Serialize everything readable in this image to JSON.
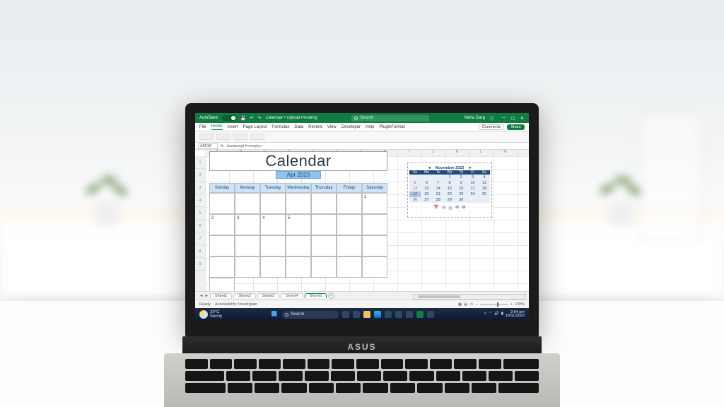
{
  "titlebar": {
    "autosave": "AutoSave",
    "doc": "Calendar • Upload Pending",
    "search_placeholder": "Search",
    "user": "Neha Garg"
  },
  "ribbon": {
    "tabs": [
      "File",
      "Home",
      "Insert",
      "Page Layout",
      "Formulas",
      "Data",
      "Review",
      "View",
      "Developer",
      "Help",
      "PlugInFormat"
    ],
    "comments": "Comments",
    "share": "Share"
  },
  "formula": {
    "cell": "A8518",
    "fx": "fx",
    "text": "Javascript #<empty>"
  },
  "columns": [
    "A",
    "B",
    "C",
    "D",
    "E",
    "F",
    "G",
    "H",
    "I",
    "J",
    "K",
    "L",
    "M"
  ],
  "rows": [
    "1",
    "2",
    "3",
    "4",
    "5",
    "6",
    "7",
    "8",
    "9"
  ],
  "calendar": {
    "title": "Calendar",
    "month_label": "Apr 2023",
    "day_headers": [
      "Sunday",
      "Monday",
      "Tuesday",
      "Wednesday",
      "Thursday",
      "Friday",
      "Saturday"
    ],
    "cells": [
      "",
      "",
      "",
      "",
      "",
      "",
      "1",
      "2",
      "3",
      "4",
      "5",
      "",
      "",
      "",
      "",
      "",
      "",
      "",
      "",
      "",
      "",
      "",
      "",
      "",
      "",
      "",
      "",
      "",
      ""
    ]
  },
  "mini": {
    "prev": "◄",
    "next": "►",
    "title": "November 2023",
    "day_abbrev": [
      "Su",
      "Mo",
      "Tu",
      "We",
      "Th",
      "Fr",
      "Sa"
    ],
    "numbers": [
      "",
      "",
      "",
      "1",
      "2",
      "3",
      "4",
      "5",
      "6",
      "7",
      "8",
      "9",
      "10",
      "11",
      "12",
      "13",
      "14",
      "15",
      "16",
      "17",
      "18",
      "19",
      "20",
      "21",
      "22",
      "23",
      "24",
      "25",
      "26",
      "27",
      "28",
      "29",
      "30",
      "",
      ""
    ],
    "sundays": [
      0,
      7,
      14,
      21,
      28
    ],
    "today_index": 21
  },
  "sheets": {
    "tabs": [
      "Sheet1",
      "Sheet2",
      "Sheet3",
      "Sheet4",
      "Sheet5"
    ],
    "active": 4,
    "add": "+"
  },
  "status": {
    "ready": "Ready",
    "access": "Accessibility: Investigate",
    "zoom": "100%"
  },
  "taskbar": {
    "temp": "29°C",
    "cond": "Sunny",
    "search": "Search",
    "time": "2:04 pm",
    "date": "19/11/2023"
  },
  "laptop_brand": "ASUS"
}
